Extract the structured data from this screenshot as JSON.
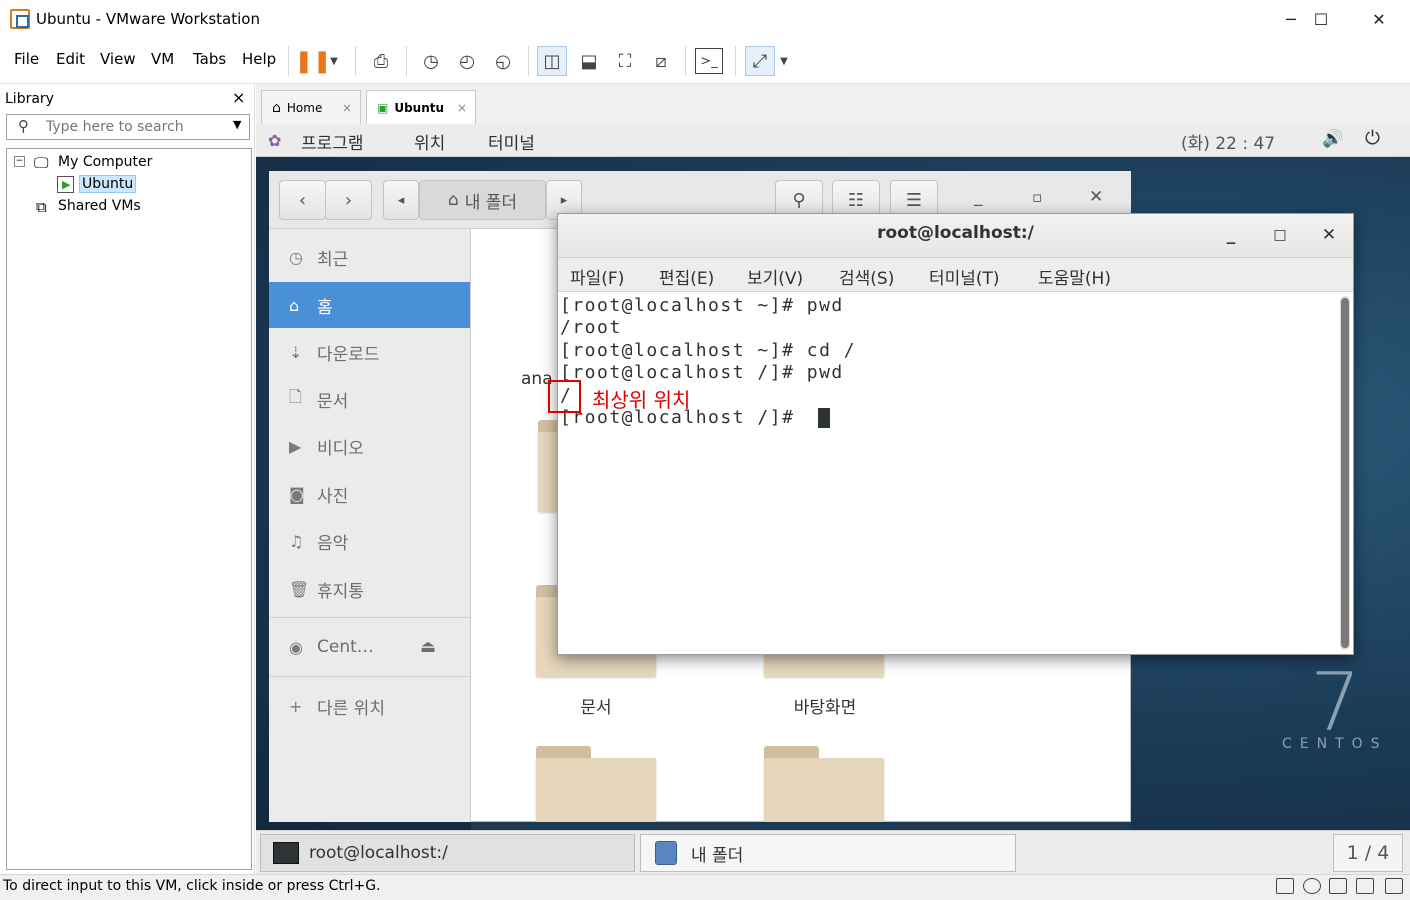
{
  "window": {
    "title": "Ubuntu - VMware Workstation",
    "minimize": "─",
    "maximize": "☐",
    "close": "✕"
  },
  "menu": {
    "file": "File",
    "edit": "Edit",
    "view": "View",
    "vm": "VM",
    "tabs": "Tabs",
    "help": "Help"
  },
  "library": {
    "title": "Library",
    "close": "×",
    "search_placeholder": "Type here to search",
    "tree": [
      {
        "label": "My Computer"
      },
      {
        "label": "Ubuntu"
      },
      {
        "label": "Shared VMs"
      }
    ]
  },
  "tabs": [
    {
      "label": "Home"
    },
    {
      "label": "Ubuntu"
    }
  ],
  "gnome": {
    "apps": "프로그램",
    "places": "위치",
    "terminal": "터미널",
    "clock": "(화) 22 : 47"
  },
  "nautilus": {
    "path_label": "내 폴더",
    "sidebar": [
      {
        "label": "최근",
        "icon": "clock-icon"
      },
      {
        "label": "홈",
        "icon": "home-icon"
      },
      {
        "label": "다운로드",
        "icon": "download-icon"
      },
      {
        "label": "문서",
        "icon": "document-icon"
      },
      {
        "label": "비디오",
        "icon": "video-icon"
      },
      {
        "label": "사진",
        "icon": "camera-icon"
      },
      {
        "label": "음악",
        "icon": "music-icon"
      },
      {
        "label": "휴지통",
        "icon": "trash-icon"
      },
      {
        "label": "Cent…",
        "icon": "disc-icon"
      },
      {
        "label": "다른 위치",
        "icon": "plus-icon"
      }
    ],
    "partial_label": "ana",
    "folders": [
      {
        "label": "문서"
      },
      {
        "label": "바탕화면"
      }
    ]
  },
  "terminal": {
    "title": "root@localhost:/",
    "menu": [
      "파일(F)",
      "편집(E)",
      "보기(V)",
      "검색(S)",
      "터미널(T)",
      "도움말(H)"
    ],
    "lines": [
      "[root@localhost ~]# pwd",
      "/root",
      "[root@localhost ~]# cd /",
      "[root@localhost /]# pwd",
      "/",
      "[root@localhost /]# "
    ]
  },
  "annotation": "최상위 위치",
  "centos": {
    "version": "7",
    "name": "CENTOS"
  },
  "window_list": [
    {
      "label": "root@localhost:/"
    },
    {
      "label": "내 폴더"
    }
  ],
  "workspace": "1 / 4",
  "status_text": "To direct input to this VM, click inside or press Ctrl+G.",
  "colors": {
    "selection": "#4a90d9",
    "annotation": "#e00000",
    "desktop": "#1c3a52"
  }
}
